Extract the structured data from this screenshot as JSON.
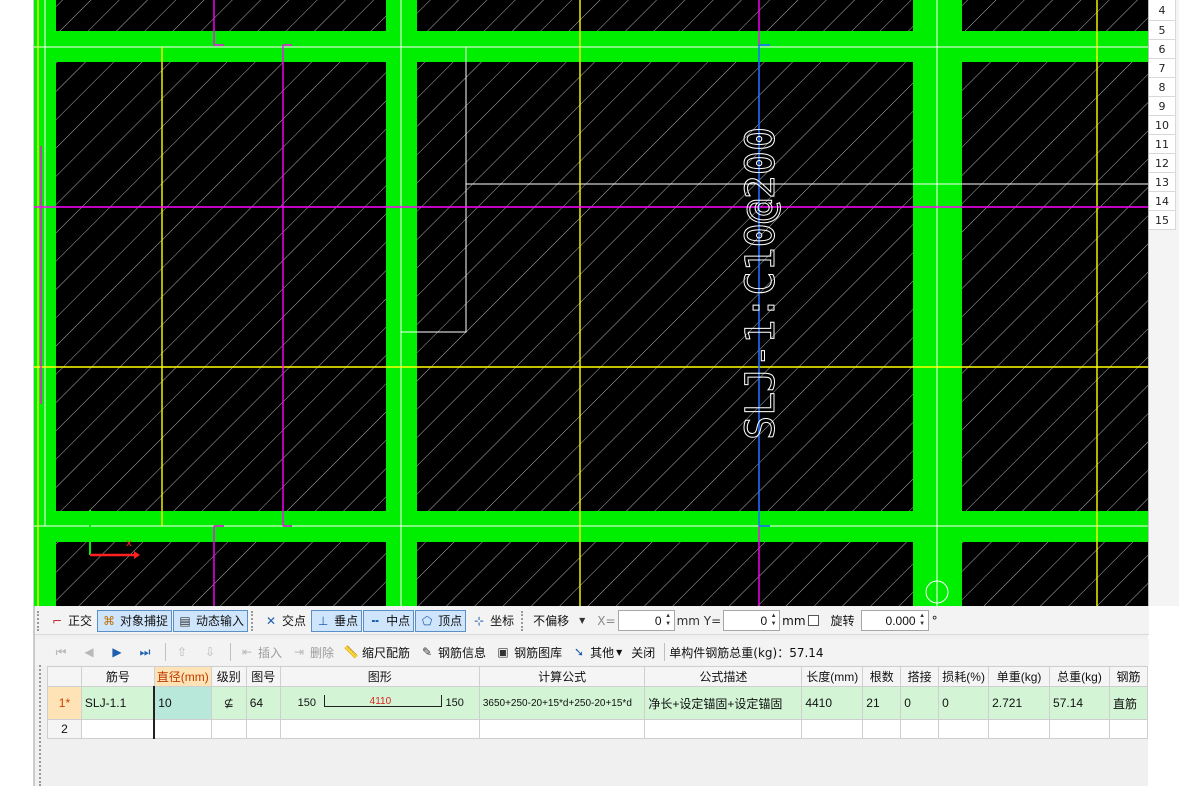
{
  "canvas": {
    "label_text": "SLJ-1:C10@200",
    "colors": {
      "background": "#000000",
      "beam": "#00ee00",
      "axis": "#ff00ff",
      "grid": "#ffff00",
      "selected": "#1e6fff",
      "line": "#ffffff"
    }
  },
  "right_panel": {
    "row_numbers": [
      "4",
      "5",
      "6",
      "7",
      "8",
      "9",
      "10",
      "11",
      "12",
      "13",
      "14",
      "15"
    ]
  },
  "toolbar1": {
    "ortho": "正交",
    "object_snap": "对象捕捉",
    "dynamic_input": "动态输入",
    "intersection": "交点",
    "perpendicular": "垂点",
    "midpoint": "中点",
    "vertex": "顶点",
    "coordinate": "坐标",
    "offset_select": "不偏移",
    "x_label": "X=",
    "x_value": "0",
    "y_label": "mm  Y=",
    "y_value": "0",
    "mm": "mm",
    "rotate_label": "旋转",
    "rotate_value": "0.000",
    "degree": "°"
  },
  "toolbar2": {
    "insert": "插入",
    "delete": "删除",
    "scale_rebar": "缩尺配筋",
    "rebar_info": "钢筋信息",
    "rebar_library": "钢筋图库",
    "other": "其他",
    "close": "关闭",
    "total_weight": "单构件钢筋总重(kg)：57.14"
  },
  "table": {
    "headers": [
      "",
      "筋号",
      "直径(mm)",
      "级别",
      "图号",
      "图形",
      "计算公式",
      "公式描述",
      "长度(mm)",
      "根数",
      "搭接",
      "损耗(%)",
      "单重(kg)",
      "总重(kg)",
      "钢筋"
    ],
    "rows": [
      {
        "row": "1*",
        "bar_no": "SLJ-1.1",
        "diameter": "10",
        "grade": "⊈",
        "figure_no": "64",
        "shape_left": "150",
        "shape_mid": "4110",
        "shape_right": "150",
        "formula": "3650+250-20+15*d+250-20+15*d",
        "description": "净长+设定锚固+设定锚固",
        "length": "4410",
        "count": "21",
        "lap": "0",
        "loss": "0",
        "unit_weight": "2.721",
        "total_weight": "57.14",
        "type": "直筋"
      },
      {
        "row": "2"
      }
    ]
  }
}
